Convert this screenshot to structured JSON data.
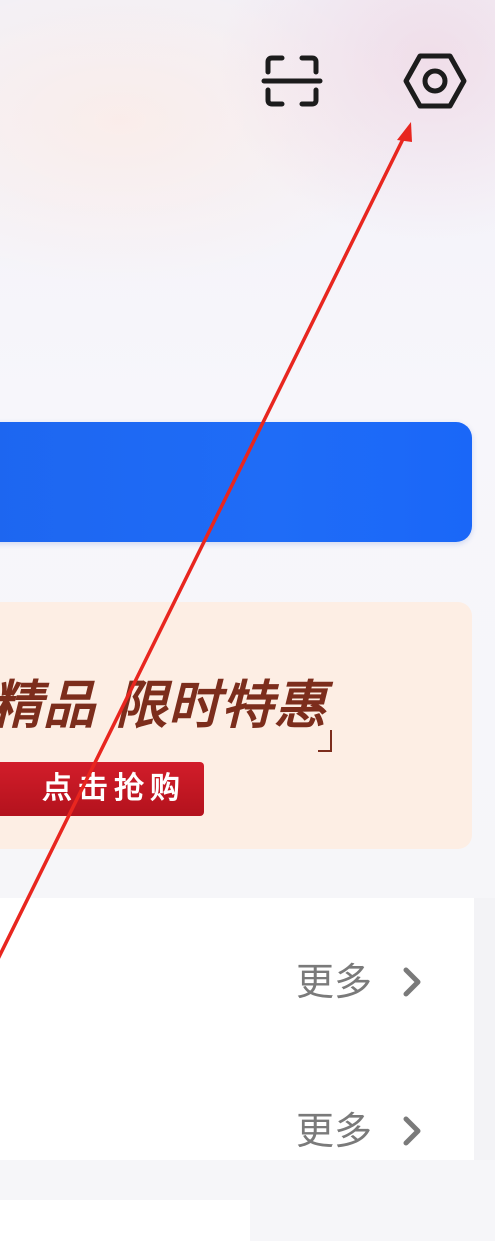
{
  "toolbar": {
    "scan_icon": "scan-icon",
    "settings_icon": "settings-icon"
  },
  "promo": {
    "title": "精品 限时特惠",
    "button_label": "点击抢购"
  },
  "list": {
    "rows": [
      {
        "more_label": "更多"
      },
      {
        "more_label": "更多"
      }
    ]
  },
  "colors": {
    "accent_blue": "#1f6cf7",
    "promo_bg": "#fdeee4",
    "promo_title": "#7c2d1c",
    "promo_button": "#c4161f",
    "annotation_arrow": "#e8261f",
    "more_text": "#7a7a7a"
  }
}
